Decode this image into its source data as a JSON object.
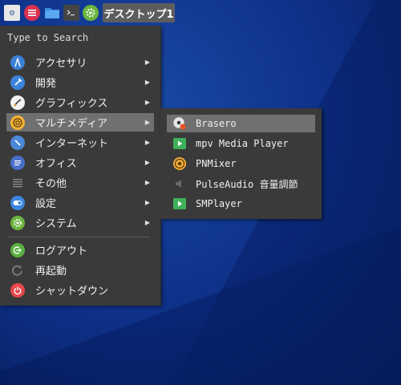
{
  "taskbar": {
    "desktop_button_label": "デスクトップ1",
    "icons": [
      "settings-icon",
      "menu-icon",
      "folder-icon",
      "terminal-icon",
      "gear-icon"
    ]
  },
  "menu": {
    "search_placeholder": "Type to Search",
    "items": [
      {
        "label": "アクセサリ",
        "icon": "accessories-icon",
        "has_submenu": true
      },
      {
        "label": "開発",
        "icon": "development-icon",
        "has_submenu": true
      },
      {
        "label": "グラフィックス",
        "icon": "graphics-icon",
        "has_submenu": true
      },
      {
        "label": "マルチメディア",
        "icon": "multimedia-icon",
        "has_submenu": true,
        "selected": true
      },
      {
        "label": "インターネット",
        "icon": "internet-icon",
        "has_submenu": true
      },
      {
        "label": "オフィス",
        "icon": "office-icon",
        "has_submenu": true
      },
      {
        "label": "その他",
        "icon": "other-icon",
        "has_submenu": true
      },
      {
        "label": "設定",
        "icon": "settings-icon",
        "has_submenu": true
      },
      {
        "label": "システム",
        "icon": "system-icon",
        "has_submenu": true
      }
    ],
    "session_items": [
      {
        "label": "ログアウト",
        "icon": "logout-icon"
      },
      {
        "label": "再起動",
        "icon": "restart-icon"
      },
      {
        "label": "シャットダウン",
        "icon": "shutdown-icon"
      }
    ]
  },
  "submenu": {
    "items": [
      {
        "label": "Brasero",
        "icon": "brasero-icon",
        "selected": true
      },
      {
        "label": "mpv Media Player",
        "icon": "mpv-icon"
      },
      {
        "label": "PNMixer",
        "icon": "pnmixer-icon"
      },
      {
        "label": "PulseAudio 音量調節",
        "icon": "speaker-icon"
      },
      {
        "label": "SMPlayer",
        "icon": "smplayer-icon"
      }
    ]
  },
  "colors": {
    "menu_bg": "#3a3a3a",
    "selection_bg": "#707070",
    "desktop_bg": "#0d2f86"
  }
}
